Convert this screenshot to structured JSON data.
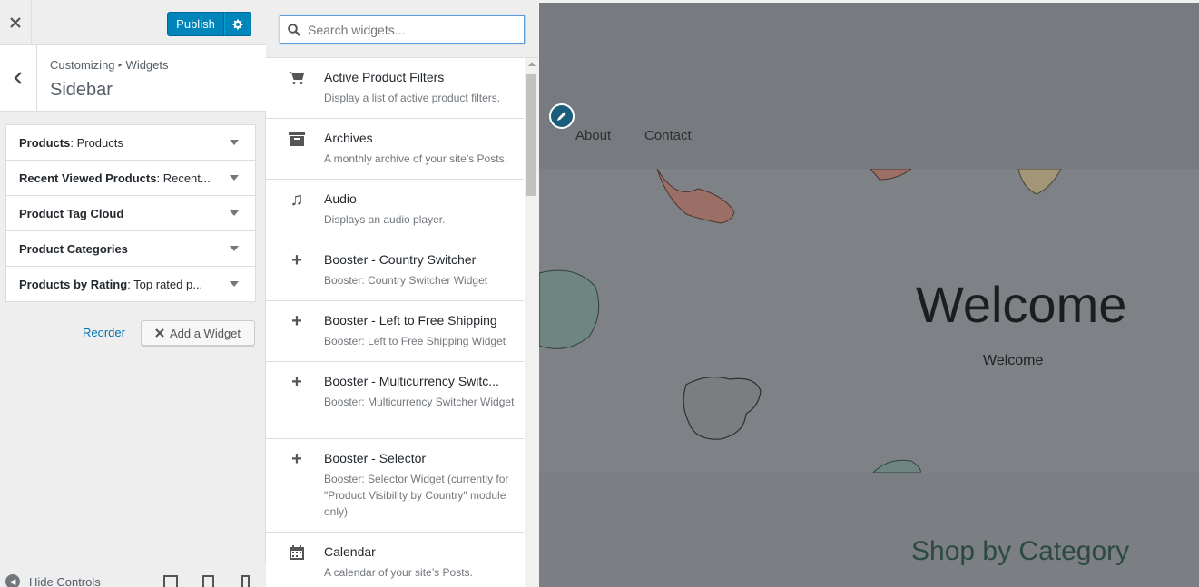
{
  "topbar": {
    "close_icon": "close-icon",
    "publish_label": "Publish",
    "settings_icon": "gear-icon"
  },
  "section": {
    "breadcrumb_root": "Customizing",
    "breadcrumb_child": "Widgets",
    "title": "Sidebar"
  },
  "sidebar_widgets": [
    {
      "label": "Products",
      "sub": ": Products"
    },
    {
      "label": "Recent Viewed Products",
      "sub": ": Recent..."
    },
    {
      "label": "Product Tag Cloud",
      "sub": ""
    },
    {
      "label": "Product Categories",
      "sub": ""
    },
    {
      "label": "Products by Rating",
      "sub": ": Top rated p..."
    }
  ],
  "actions": {
    "reorder_label": "Reorder",
    "add_widget_label": "Add a Widget"
  },
  "footer": {
    "hide_controls_label": "Hide Controls"
  },
  "search": {
    "placeholder": "Search widgets..."
  },
  "available_widgets": [
    {
      "icon": "cart-icon",
      "title": "Active Product Filters",
      "desc": "Display a list of active product filters."
    },
    {
      "icon": "archive-icon",
      "title": "Archives",
      "desc": "A monthly archive of your site’s Posts."
    },
    {
      "icon": "music-icon",
      "title": "Audio",
      "desc": "Displays an audio player."
    },
    {
      "icon": "plus-icon",
      "title": "Booster - Country Switcher",
      "desc": "Booster: Country Switcher Widget"
    },
    {
      "icon": "plus-icon",
      "title": "Booster - Left to Free Shipping",
      "desc": "Booster: Left to Free Shipping Widget"
    },
    {
      "icon": "plus-icon",
      "title": "Booster - Multicurrency Switc...",
      "desc": "Booster: Multicurrency Switcher Widget"
    },
    {
      "icon": "plus-icon",
      "title": "Booster - Selector",
      "desc": "Booster: Selector Widget (currently for \"Product Visibility by Country\" module only)"
    },
    {
      "icon": "calendar-icon",
      "title": "Calendar",
      "desc": "A calendar of your site’s Posts."
    }
  ],
  "preview": {
    "nav_about": "About",
    "nav_contact": "Contact",
    "hero_title": "Welcome",
    "hero_subtitle": "Welcome",
    "shop_title": "Shop by Category"
  },
  "colors": {
    "primary_blue": "#0085ba",
    "link_blue": "#0073aa",
    "overlay_gray": "#7a7d81"
  }
}
